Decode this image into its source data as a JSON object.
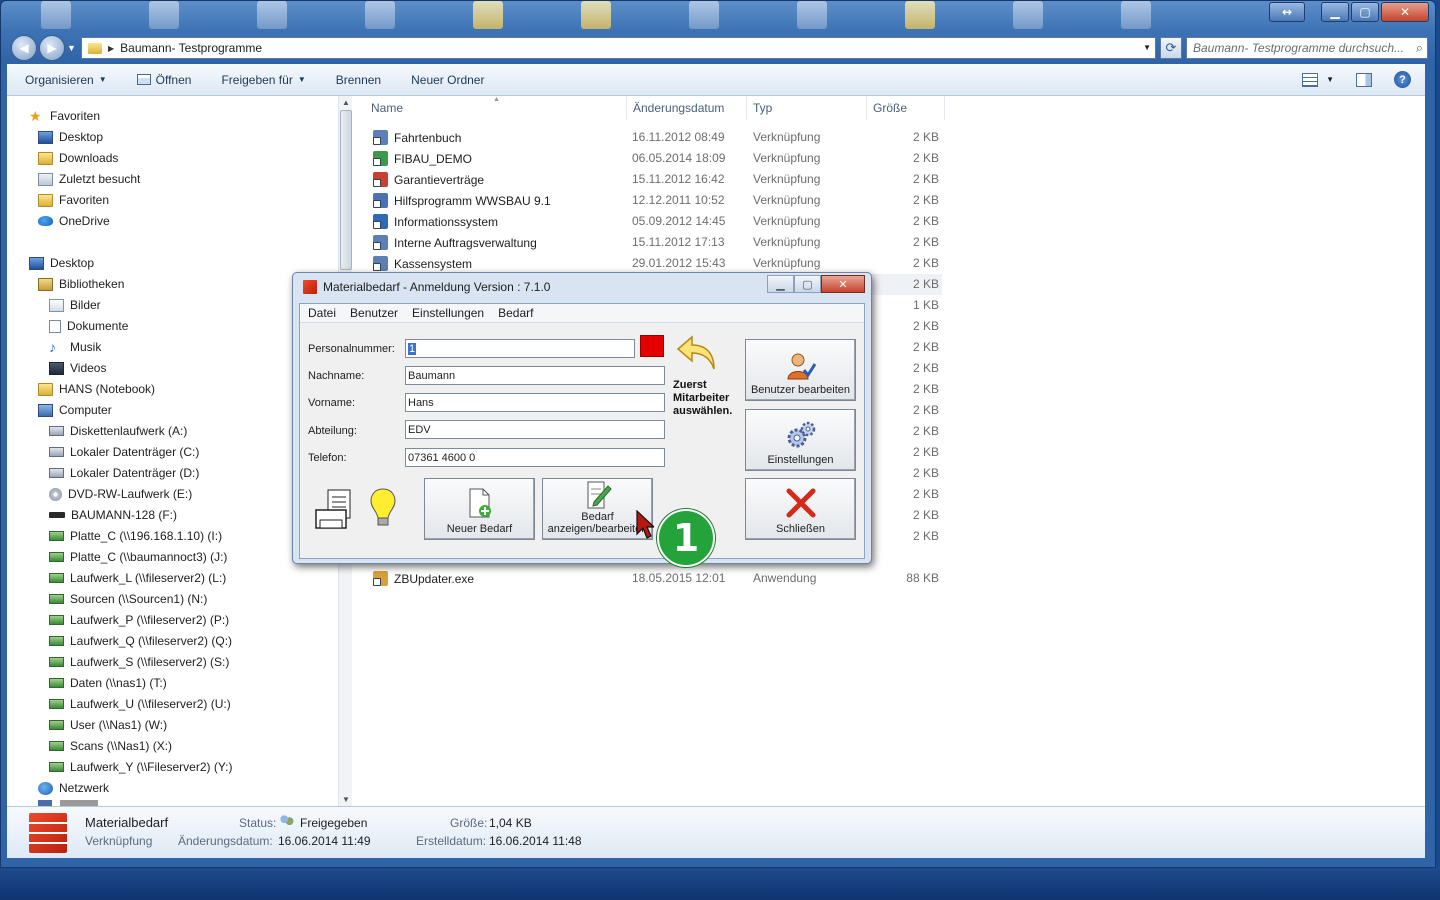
{
  "window": {
    "address_path": "Baumann- Testprogramme",
    "search_placeholder": "Baumann- Testprogramme durchsuch..."
  },
  "toolbar": {
    "items": [
      "Organisieren",
      "Öffnen",
      "Freigeben für",
      "Brennen",
      "Neuer Ordner"
    ]
  },
  "sidebar": {
    "items": [
      {
        "label": "Favoriten",
        "icon": "star-icon"
      },
      {
        "label": "Desktop",
        "icon": "desktop-icon"
      },
      {
        "label": "Downloads",
        "icon": "folder-icon"
      },
      {
        "label": "Zuletzt besucht",
        "icon": "recent-icon"
      },
      {
        "label": "Favoriten",
        "icon": "folder-icon"
      },
      {
        "label": "OneDrive",
        "icon": "cloud-icon"
      },
      {
        "label": "Desktop",
        "icon": "desktop-icon"
      },
      {
        "label": "Bibliotheken",
        "icon": "library-icon"
      },
      {
        "label": "Bilder",
        "icon": "pictures-icon"
      },
      {
        "label": "Dokumente",
        "icon": "documents-icon"
      },
      {
        "label": "Musik",
        "icon": "music-icon"
      },
      {
        "label": "Videos",
        "icon": "video-icon"
      },
      {
        "label": "HANS (Notebook)",
        "icon": "folder-icon"
      },
      {
        "label": "Computer",
        "icon": "computer-icon"
      },
      {
        "label": "Diskettenlaufwerk (A:)",
        "icon": "floppy-icon"
      },
      {
        "label": "Lokaler Datenträger (C:)",
        "icon": "drive-icon"
      },
      {
        "label": "Lokaler Datenträger (D:)",
        "icon": "drive-icon"
      },
      {
        "label": "DVD-RW-Laufwerk (E:)",
        "icon": "dvd-icon"
      },
      {
        "label": "BAUMANN-128 (F:)",
        "icon": "usb-icon"
      },
      {
        "label": "Platte_C (\\\\196.168.1.10) (I:)",
        "icon": "network-drive-icon"
      },
      {
        "label": "Platte_C (\\\\baumannoct3) (J:)",
        "icon": "network-drive-icon"
      },
      {
        "label": "Laufwerk_L (\\\\fileserver2) (L:)",
        "icon": "network-drive-icon"
      },
      {
        "label": "Sourcen (\\\\Sourcen1) (N:)",
        "icon": "network-drive-icon"
      },
      {
        "label": "Laufwerk_P (\\\\fileserver2) (P:)",
        "icon": "network-drive-icon"
      },
      {
        "label": "Laufwerk_Q (\\\\fileserver2) (Q:)",
        "icon": "network-drive-icon"
      },
      {
        "label": "Laufwerk_S (\\\\fileserver2) (S:)",
        "icon": "network-drive-icon"
      },
      {
        "label": "Daten (\\\\nas1) (T:)",
        "icon": "network-drive-icon"
      },
      {
        "label": "Laufwerk_U (\\\\fileserver2) (U:)",
        "icon": "network-drive-icon"
      },
      {
        "label": "User (\\\\Nas1) (W:)",
        "icon": "network-drive-icon"
      },
      {
        "label": "Scans (\\\\Nas1) (X:)",
        "icon": "network-drive-icon"
      },
      {
        "label": "Laufwerk_Y (\\\\Fileserver2) (Y:)",
        "icon": "network-drive-icon"
      },
      {
        "label": "Netzwerk",
        "icon": "network-icon"
      }
    ]
  },
  "filelist": {
    "headers": {
      "name": "Name",
      "date": "Änderungsdatum",
      "type": "Typ",
      "size": "Größe"
    },
    "rows": [
      {
        "name": "Fahrtenbuch",
        "date": "16.11.2012 08:49",
        "type": "Verknüpfung",
        "size": "2 KB",
        "color": "#5b7fb6"
      },
      {
        "name": "FIBAU_DEMO",
        "date": "06.05.2014 18:09",
        "type": "Verknüpfung",
        "size": "2 KB",
        "color": "#3a9a4a"
      },
      {
        "name": "Garantieverträge",
        "date": "15.11.2012 16:42",
        "type": "Verknüpfung",
        "size": "2 KB",
        "color": "#c9402d"
      },
      {
        "name": "Hilfsprogramm WWSBAU 9.1",
        "date": "12.12.2011 10:52",
        "type": "Verknüpfung",
        "size": "2 KB",
        "color": "#4a73b3"
      },
      {
        "name": "Informationssystem",
        "date": "05.09.2012 14:45",
        "type": "Verknüpfung",
        "size": "2 KB",
        "color": "#2e69b7"
      },
      {
        "name": "Interne Auftragsverwaltung",
        "date": "15.11.2012 17:13",
        "type": "Verknüpfung",
        "size": "2 KB",
        "color": "#5b7fb6"
      },
      {
        "name": "Kassensystem",
        "date": "29.01.2012 15:43",
        "type": "Verknüpfung",
        "size": "2 KB",
        "color": "#5b7fb6"
      }
    ],
    "hidden_sizes": [
      "2 KB",
      "1 KB",
      "2 KB",
      "2 KB",
      "2 KB",
      "2 KB",
      "2 KB",
      "2 KB",
      "2 KB",
      "2 KB",
      "2 KB",
      "2 KB",
      "2 KB"
    ],
    "last_row": {
      "name": "ZBUpdater.exe",
      "date": "18.05.2015 12:01",
      "type": "Anwendung",
      "size": "88 KB",
      "color": "#d9a13a"
    }
  },
  "details": {
    "name": "Materialbedarf",
    "kind": "Verknüpfung",
    "status_label": "Status:",
    "status_value": "Freigegeben",
    "mod_label": "Änderungsdatum:",
    "mod_value": "16.06.2014 11:49",
    "size_label": "Größe:",
    "size_value": "1,04 KB",
    "created_label": "Erstelldatum:",
    "created_value": "16.06.2014 11:48"
  },
  "dialog": {
    "title": "Materialbedarf - Anmeldung Version : 7.1.0",
    "menu": [
      "Datei",
      "Benutzer",
      "Einstellungen",
      "Bedarf"
    ],
    "fields": {
      "personalnummer": {
        "label": "Personalnummer:",
        "value": "1"
      },
      "nachname": {
        "label": "Nachname:",
        "value": "Baumann"
      },
      "vorname": {
        "label": "Vorname:",
        "value": "Hans"
      },
      "abteilung": {
        "label": "Abteilung:",
        "value": "EDV"
      },
      "telefon": {
        "label": "Telefon:",
        "value": "07361 4600 0"
      }
    },
    "hint_lines": [
      "Zuerst",
      "Mitarbeiter",
      "auswählen."
    ],
    "buttons": {
      "benutzer": "Benutzer bearbeiten",
      "einstellungen": "Einstellungen",
      "neuer_bedarf": "Neuer Bedarf",
      "bedarf_line1": "Bedarf",
      "bedarf_line2": "anzeigen/bearbeiten",
      "schliessen": "Schließen"
    },
    "badge": "1",
    "status_color": "#e50000",
    "badge_color": "#23a33a"
  }
}
